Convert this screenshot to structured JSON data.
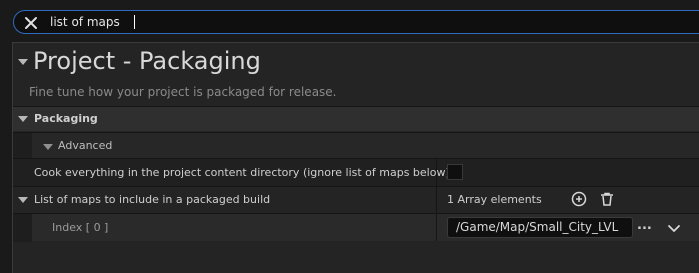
{
  "search": {
    "value": "list of maps",
    "clear_icon": "close-x-icon"
  },
  "section": {
    "title": "Project - Packaging",
    "description": "Fine tune how your project is packaged for release."
  },
  "category": {
    "label": "Packaging"
  },
  "advanced": {
    "label": "Advanced"
  },
  "cook_everything": {
    "label": "Cook everything in the project content directory (ignore list of maps below)",
    "checked": false
  },
  "list_of_maps": {
    "label": "List of maps to include in a packaged build",
    "count_text": "1 Array elements",
    "add_icon": "add-circle-icon",
    "delete_icon": "trash-icon",
    "items": [
      {
        "index_label": "Index [ 0 ]",
        "value": "/Game/Map/Small_City_LVL",
        "more_label": "..."
      }
    ]
  }
}
